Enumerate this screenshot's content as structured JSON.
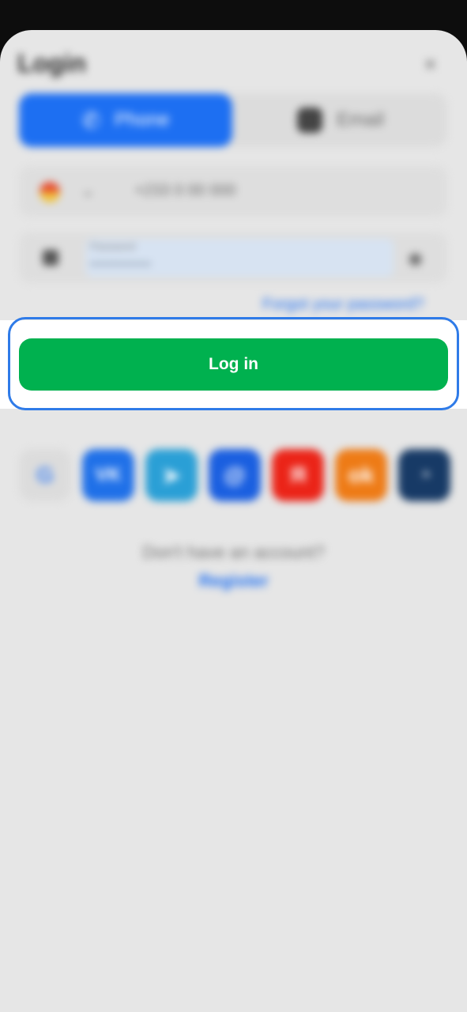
{
  "dialog": {
    "title": "Login",
    "close_glyph": "×"
  },
  "tabs": [
    {
      "label": "Phone",
      "active": true,
      "icon": "phone-icon"
    },
    {
      "label": "Email",
      "active": false,
      "icon": "email-icon"
    }
  ],
  "phone_field": {
    "country_flag": "flag-icon",
    "chevron_glyph": "⌄",
    "value": "+233 0 00 000"
  },
  "password_field": {
    "label": "Password",
    "value": "••••••••••••••",
    "eye_glyph": "◉"
  },
  "forgot_link": "Forgot your password?",
  "login_button": "Log in",
  "social_logins": [
    {
      "name": "google-icon",
      "glyph": "G"
    },
    {
      "name": "vk-icon",
      "glyph": "VK"
    },
    {
      "name": "telegram-icon",
      "glyph": "➤"
    },
    {
      "name": "mail-icon",
      "glyph": "@"
    },
    {
      "name": "yandex-icon",
      "glyph": "Я"
    },
    {
      "name": "odnoklassniki-icon",
      "glyph": "ok"
    },
    {
      "name": "steam-icon",
      "glyph": "◔"
    }
  ],
  "footer": {
    "no_account": "Don't have an account?",
    "register": "Register"
  },
  "colors": {
    "accent_blue": "#1d6ff2",
    "login_green": "#00b14f",
    "focus_ring": "#2f7be8"
  }
}
